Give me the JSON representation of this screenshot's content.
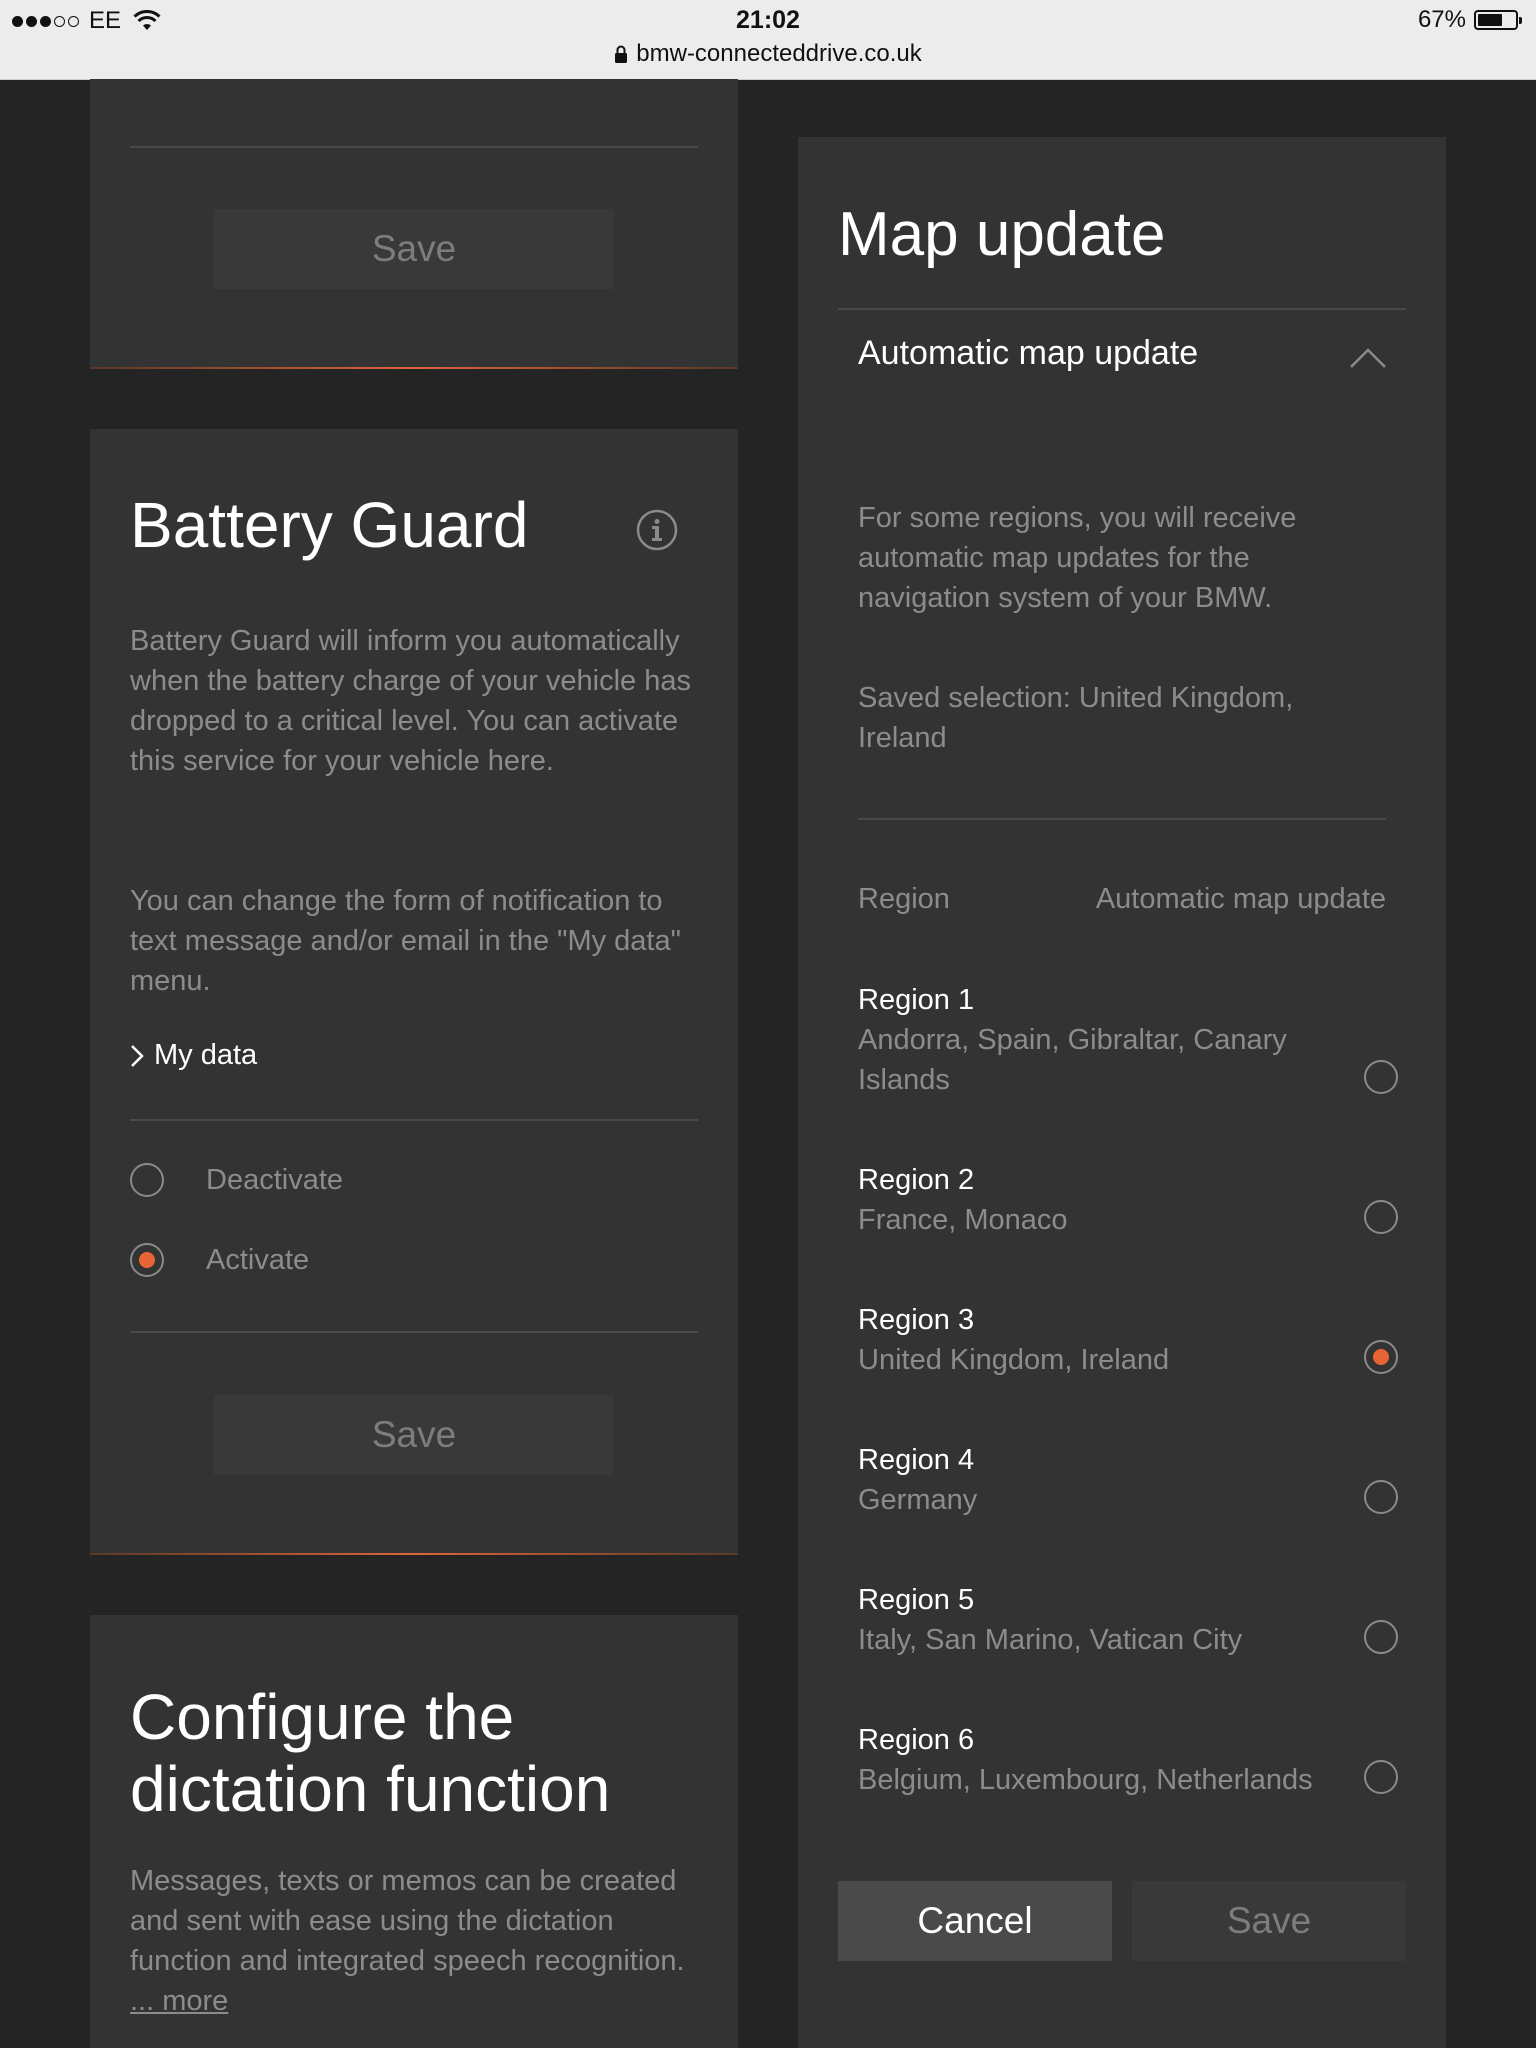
{
  "status_bar": {
    "carrier": "EE",
    "time": "21:02",
    "battery_percent": "67%",
    "battery_level": 0.67,
    "url": "bmw-connecteddrive.co.uk"
  },
  "top_card": {
    "save_label": "Save"
  },
  "battery_guard": {
    "title": "Battery Guard",
    "description": "Battery Guard will inform you automatically when the battery charge of your vehicle has dropped to a critical level. You can activate this service for your vehicle here.",
    "notification_text": "You can change the form of notification to text message and/or email in the \"My data\" menu.",
    "my_data_link": "My data",
    "options": [
      {
        "label": "Deactivate",
        "selected": false
      },
      {
        "label": "Activate",
        "selected": true
      }
    ],
    "save_label": "Save"
  },
  "dictation": {
    "title_line1": "Configure the",
    "title_line2": "dictation function",
    "description": "Messages, texts or memos can be created and sent with ease using the dictation function and integrated speech recognition.",
    "more_link": "... more"
  },
  "map_update": {
    "title": "Map update",
    "accordion_title": "Automatic map update",
    "intro": "For some regions, you will receive automatic map updates for the navigation system of your BMW.",
    "saved_selection": "Saved selection: United Kingdom, Ireland",
    "col_region": "Region",
    "col_auto": "Automatic map update",
    "regions": [
      {
        "name": "Region 1",
        "countries": "Andorra, Spain, Gibraltar, Canary Islands",
        "selected": false
      },
      {
        "name": "Region 2",
        "countries": "France, Monaco",
        "selected": false
      },
      {
        "name": "Region 3",
        "countries": "United Kingdom, Ireland",
        "selected": true
      },
      {
        "name": "Region 4",
        "countries": "Germany",
        "selected": false
      },
      {
        "name": "Region 5",
        "countries": "Italy, San Marino, Vatican City",
        "selected": false
      },
      {
        "name": "Region 6",
        "countries": "Belgium, Luxembourg, Netherlands",
        "selected": false
      }
    ],
    "cancel_label": "Cancel",
    "save_label": "Save"
  },
  "colors": {
    "accent": "#e86434",
    "background": "#242424",
    "card": "#333333"
  }
}
